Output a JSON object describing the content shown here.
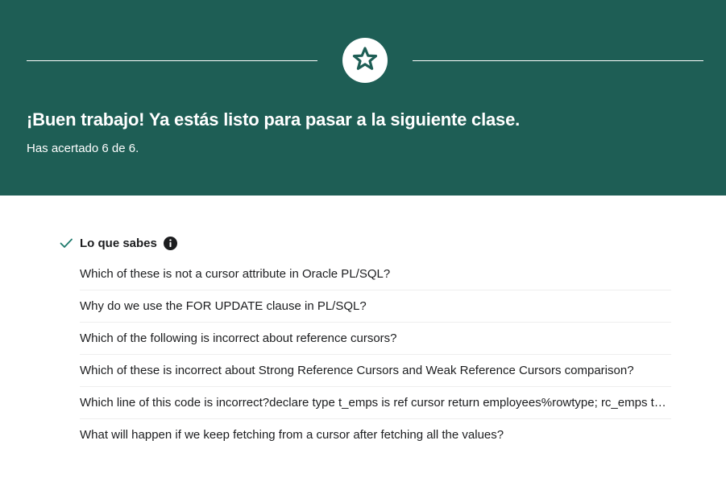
{
  "colors": {
    "banner": "#1e5e55",
    "check": "#1e7a6c"
  },
  "banner": {
    "icon": "star-icon",
    "headline": "¡Buen trabajo! Ya estás listo para pasar a la siguiente clase.",
    "score": "Has acertado 6 de 6."
  },
  "section": {
    "icon": "check-icon",
    "title": "Lo que sabes",
    "info_icon": "info-icon"
  },
  "questions": [
    "Which of these is not a cursor attribute in Oracle PL/SQL?",
    "Why do we use the FOR UPDATE clause in PL/SQL?",
    "Which of the following is incorrect about reference cursors?",
    "Which of these is incorrect about Strong Reference Cursors and Weak Reference Cursors comparison?",
    "Which line of this code is incorrect?declare type t_emps is ref cursor return employees%rowtype; rc_emps t_emps; r_emps employees%rowtype;",
    "What will happen if we keep fetching from a cursor after fetching all the values?"
  ]
}
